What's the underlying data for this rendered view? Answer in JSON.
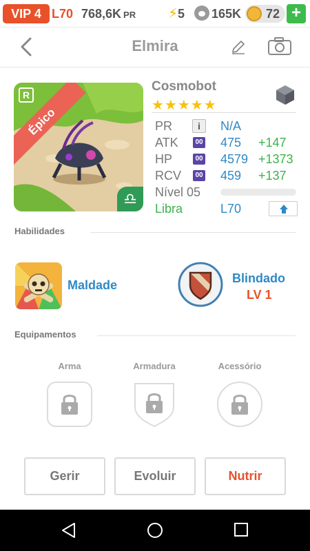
{
  "status_bar": {
    "vip": "VIP 4",
    "level": "L70",
    "gold": "768,6K",
    "gold_unit": "PR",
    "energy": "5",
    "food": "165K",
    "gems": "72",
    "add_label": "+",
    "icons": [
      "bolt-icon",
      "paw-icon",
      "coin-icon",
      "plus-icon"
    ]
  },
  "header": {
    "title": "Elmira",
    "icons": [
      "back-icon",
      "edit-icon",
      "camera-icon"
    ]
  },
  "monster": {
    "rarity_letter": "R",
    "rarity": "Épico",
    "name": "Cosmobot",
    "stars": "★★★★★",
    "sign_symbol": "♎",
    "element": "metal",
    "stats": {
      "pr_label": "PR",
      "pr_info": "i",
      "pr_value": "N/A",
      "atk_label": "ATK",
      "atk_box": "00",
      "atk_value": "475",
      "atk_bonus": "+147",
      "hp_label": "HP",
      "hp_box": "00",
      "hp_value": "4579",
      "hp_bonus": "+1373",
      "rcv_label": "RCV",
      "rcv_box": "00",
      "rcv_value": "459",
      "rcv_bonus": "+137",
      "level_label": "Nível 05",
      "level_progress": 0,
      "sign_label": "Libra",
      "max_level": "L70"
    }
  },
  "skills": {
    "heading": "Habilidades",
    "leader": {
      "name": "Maldade",
      "icon": "skull-icon"
    },
    "active": {
      "name": "Blindado",
      "level": "LV 1",
      "icon": "shield-icon"
    }
  },
  "equipment": {
    "heading": "Equipamentos",
    "slots": [
      {
        "label": "Arma"
      },
      {
        "label": "Armadura"
      },
      {
        "label": "Acessório"
      }
    ]
  },
  "actions": {
    "manage": "Gerir",
    "evolve": "Evoluir",
    "feed": "Nutrir"
  },
  "colors": {
    "accent_orange": "#e8512a",
    "value_blue": "#2f89c6",
    "bonus_green": "#3bb24b",
    "star_yellow": "#f7c10d"
  }
}
